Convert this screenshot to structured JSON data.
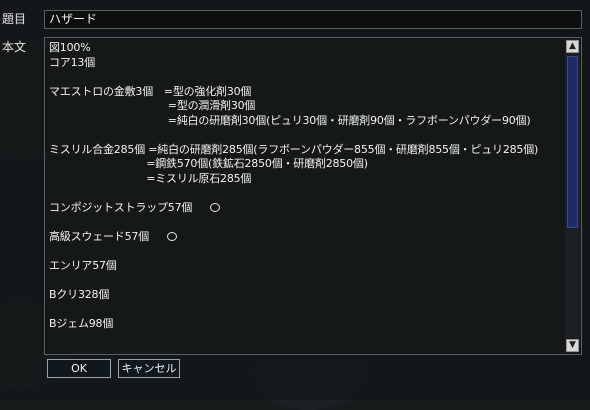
{
  "form": {
    "subject_label": "題目",
    "body_label": "本文",
    "subject_value": "ハザード"
  },
  "body_lines": [
    {
      "text": "図100%"
    },
    {
      "text": "コア13個"
    },
    {
      "text": ""
    },
    {
      "text": "マエストロの金敷3個　=型の強化剤30個"
    },
    {
      "text": "　　　　　　　　　　　=型の潤滑剤30個"
    },
    {
      "text": "　　　　　　　　　　　=純白の研磨剤30個(ピュリ30個・研磨剤90個・ラフボーンパウダー90個)"
    },
    {
      "text": ""
    },
    {
      "text": "ミスリル合金285個 =純白の研磨剤285個(ラフボーンパウダー855個・研磨剤855個・ピュリ285個)"
    },
    {
      "text": "　　　　　　　　　=鋼鉄570個(鉄鉱石2850個・研磨剤2850個)"
    },
    {
      "text": "　　　　　　　　　=ミスリル原石285個"
    },
    {
      "text": ""
    },
    {
      "text": "コンポジットストラップ57個",
      "mark": true
    },
    {
      "text": ""
    },
    {
      "text": "高級スウェード57個",
      "mark": true
    },
    {
      "text": ""
    },
    {
      "text": "エンリア57個"
    },
    {
      "text": ""
    },
    {
      "text": "Bクリ328個"
    },
    {
      "text": ""
    },
    {
      "text": "Bジェム98個"
    }
  ],
  "buttons": {
    "ok": "OK",
    "cancel": "キャンセル"
  },
  "icons": {
    "scroll_up": "arrow-up-icon",
    "scroll_down": "arrow-down-icon",
    "check_mark": "circle-mark-icon"
  },
  "colors": {
    "scroll_thumb": "#1e2a66",
    "background": "#171b1c"
  }
}
